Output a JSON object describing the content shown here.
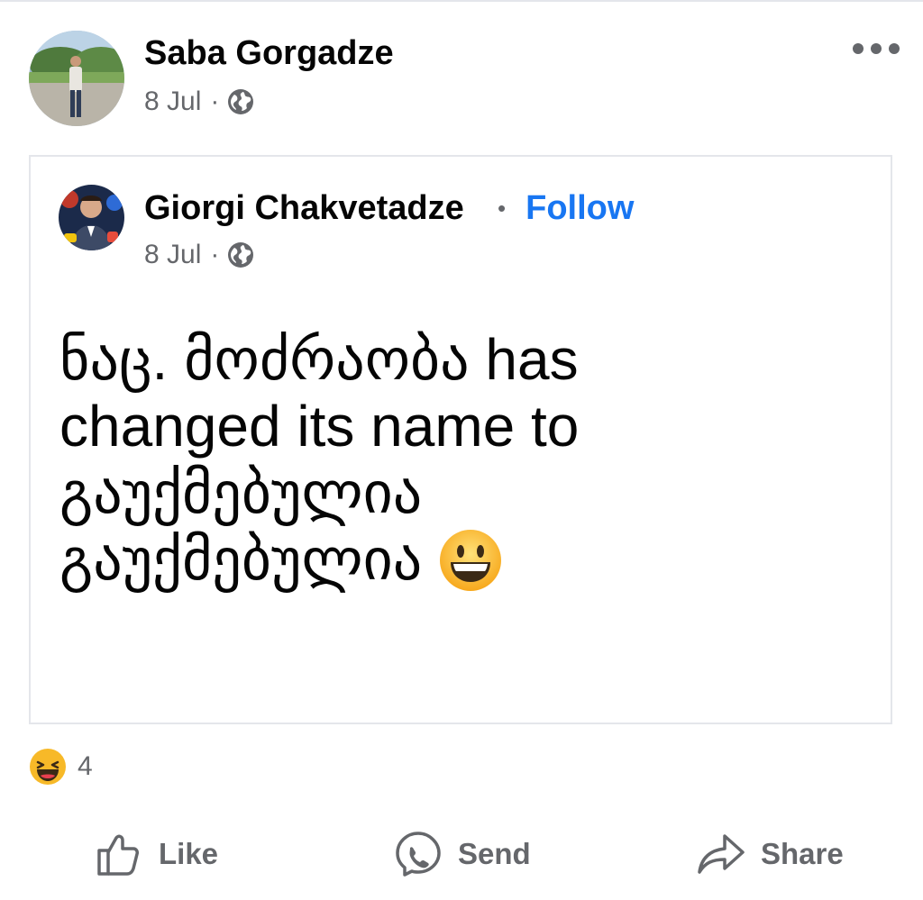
{
  "outer_post": {
    "author": "Saba Gorgadze",
    "date": "8 Jul",
    "separator": "·"
  },
  "shared_post": {
    "author": "Giorgi Chakvetadze",
    "follow_separator": "•",
    "follow_label": "Follow",
    "date": "8 Jul",
    "separator": "·",
    "text_lines": [
      "ნაც. მოძრაობა has",
      "changed its name to",
      "გაუქმებულია",
      "გაუქმებულია"
    ]
  },
  "reactions": {
    "count": "4"
  },
  "actions": {
    "like": "Like",
    "send": "Send",
    "share": "Share"
  },
  "colors": {
    "link": "#1876f2",
    "secondary_text": "#65676b",
    "border": "#e4e6eb"
  }
}
